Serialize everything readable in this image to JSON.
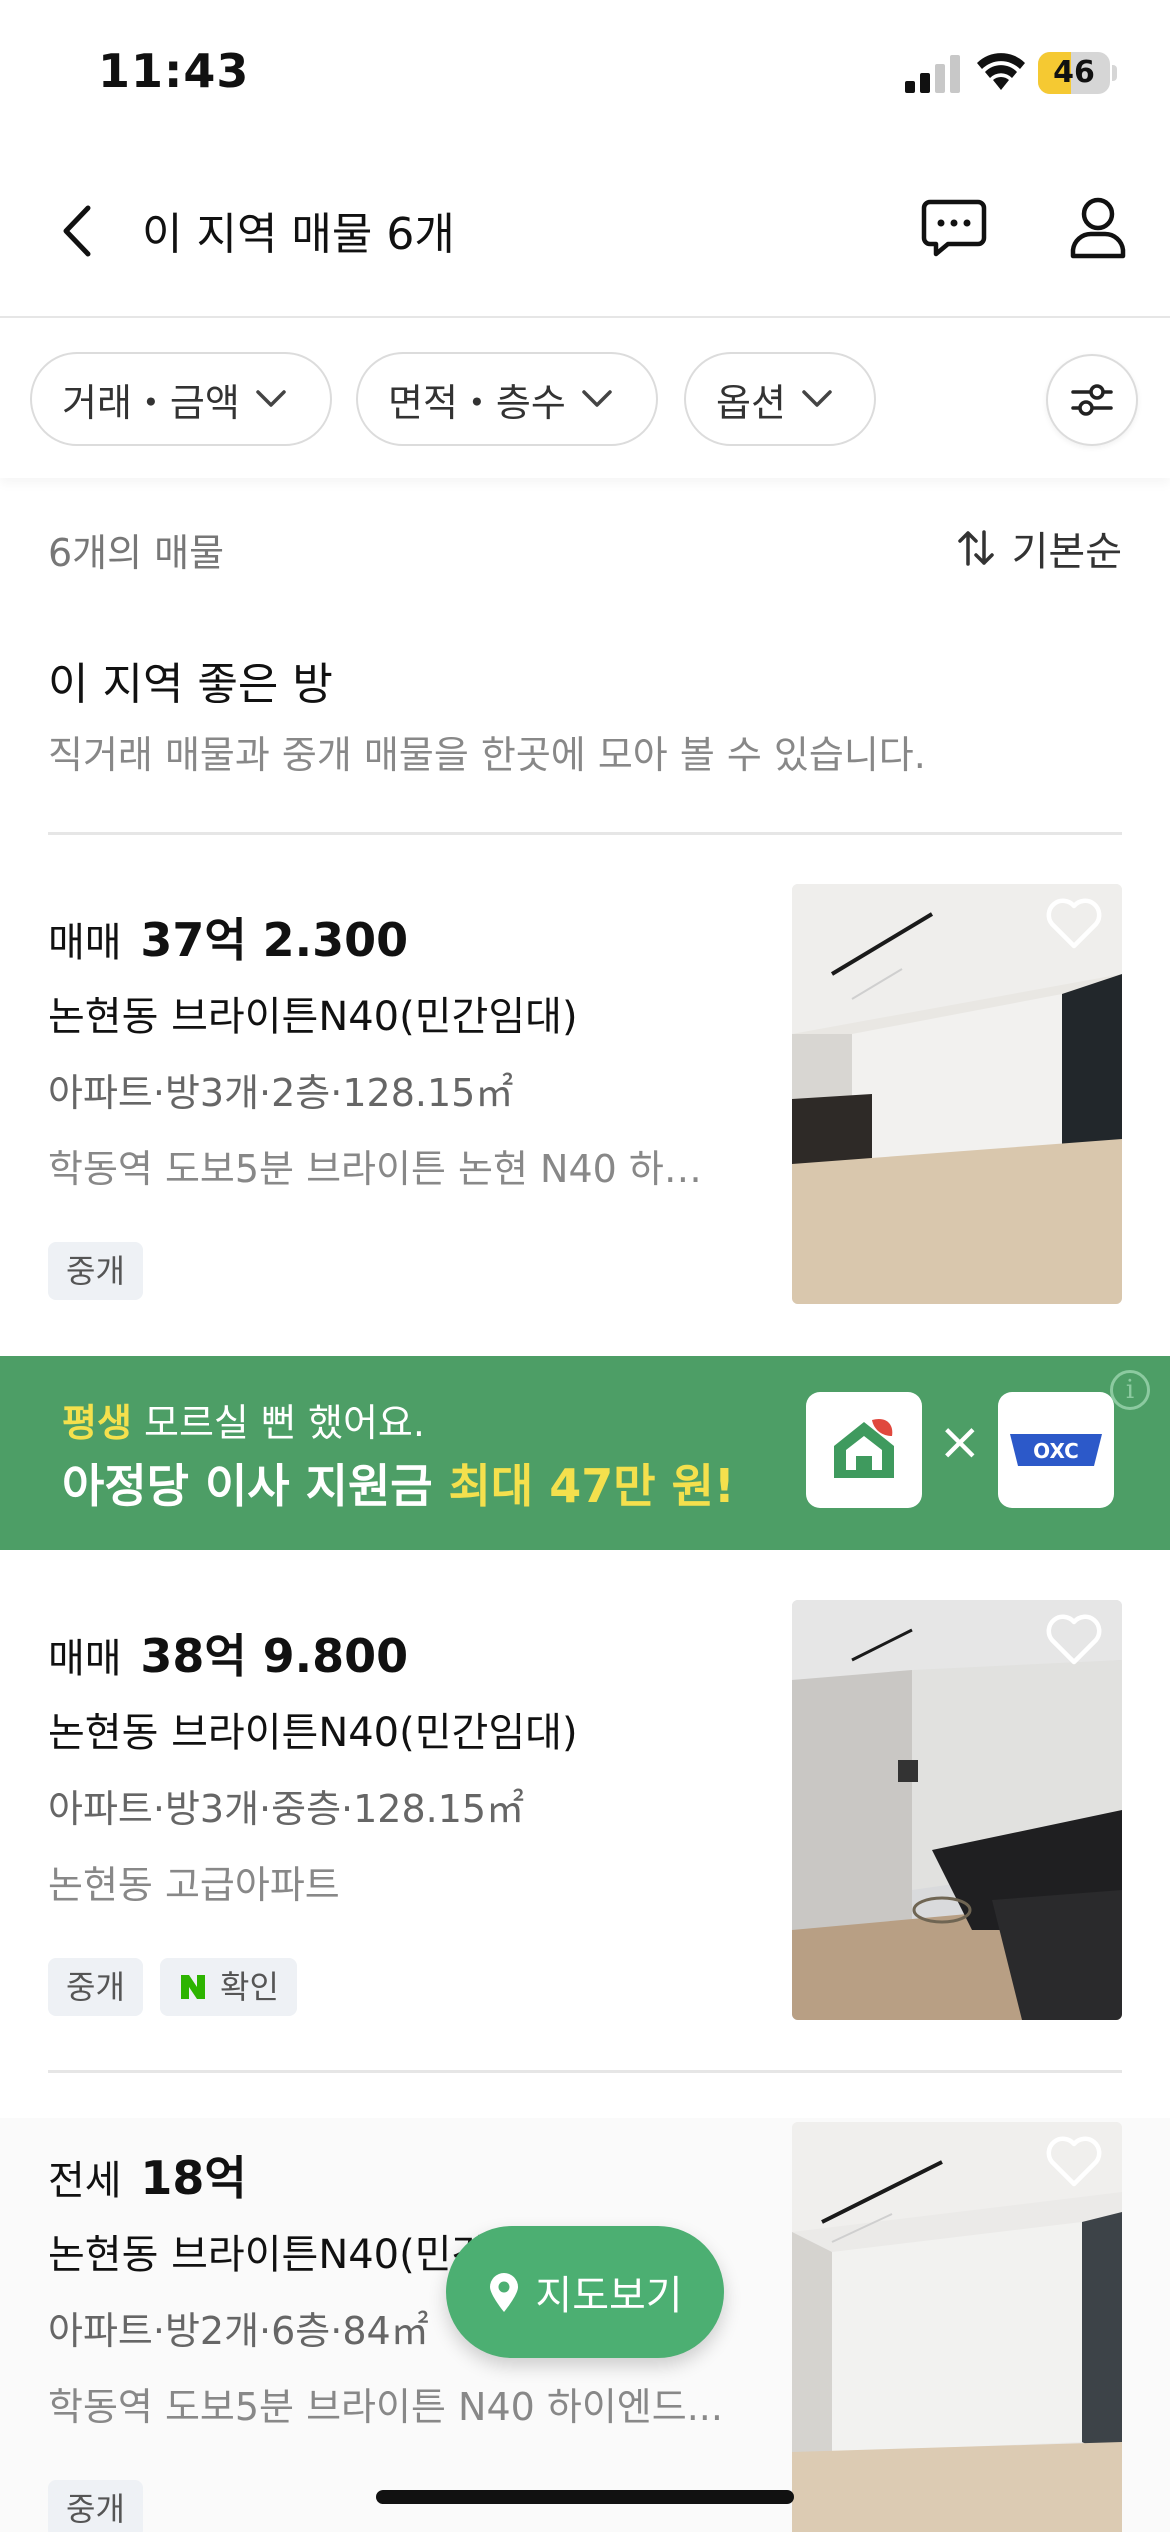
{
  "status": {
    "time": "11:43",
    "battery": "46",
    "battery_level": 0.46
  },
  "nav": {
    "title": "이 지역 매물 6개"
  },
  "filters": {
    "chips": [
      "거래・금액",
      "면적・층수",
      "옵션"
    ]
  },
  "list_header": {
    "count": "6개의 매물",
    "sort": "기본순"
  },
  "section": {
    "title": "이 지역 좋은 방",
    "subtitle": "직거래 매물과 중개 매물을 한곳에 모아 볼 수 있습니다."
  },
  "listings": [
    {
      "deal_type": "매매",
      "price": "37억 2.300",
      "name": "논현동 브라이튼N40(민간임대)",
      "meta": "아파트·방3개·2층·128.15㎡",
      "desc": " 학동역 도보5분 브라이튼 논현 N40 하…",
      "tags": [
        "중개"
      ]
    },
    {
      "deal_type": "매매",
      "price": "38억 9.800",
      "name": "논현동 브라이튼N40(민간임대)",
      "meta": "아파트·방3개·중층·128.15㎡",
      "desc": "논현동 고급아파트",
      "tags": [
        "중개",
        "확인"
      ]
    },
    {
      "deal_type": "전세",
      "price": "18억",
      "name": "논현동 브라이튼N40(민간",
      "meta": "아파트·방2개·6층·84㎡",
      "desc": " 학동역 도보5분 브라이튼 N40 하이엔드...",
      "tags": [
        "중개"
      ]
    }
  ],
  "banner": {
    "line1_highlight": "평생",
    "line1_rest": " 모르실 뻔 했어요.",
    "line2_main": "아정당 이사 지원금 ",
    "line2_highlight": "최대 47만 원!",
    "x_symbol": "×",
    "partner_logo_text": "OXC",
    "info_symbol": "i"
  },
  "map_button": {
    "label": "지도보기"
  },
  "colors": {
    "accent_green": "#4caf72",
    "banner_green": "#4d9e66",
    "highlight_yellow": "#f4e04d",
    "battery_yellow": "#f5c932"
  }
}
